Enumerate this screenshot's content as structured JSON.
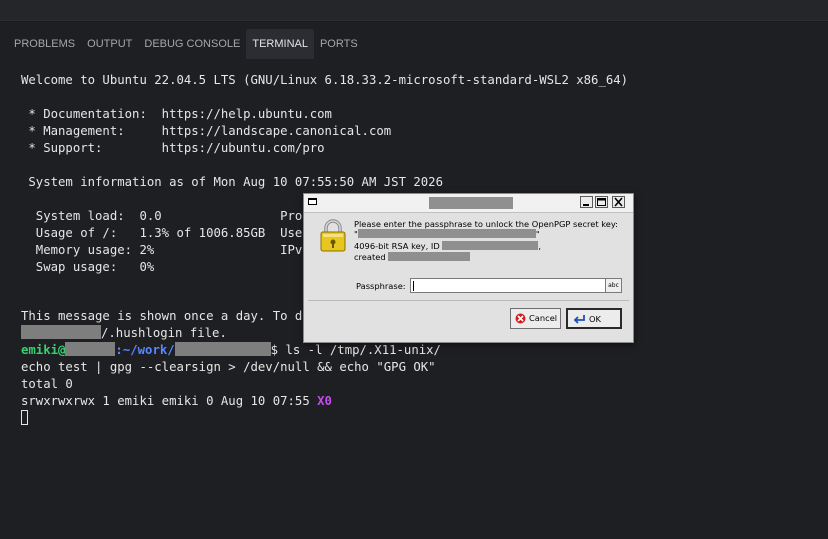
{
  "panel": {
    "tabs": [
      {
        "label": "PROBLEMS"
      },
      {
        "label": "OUTPUT"
      },
      {
        "label": "DEBUG CONSOLE"
      },
      {
        "label": "TERMINAL",
        "active": true
      },
      {
        "label": "PORTS"
      }
    ]
  },
  "terminal": {
    "welcome": "Welcome to Ubuntu 22.04.5 LTS (GNU/Linux 6.18.33.2-microsoft-standard-WSL2 x86_64)",
    "doc": " * Documentation:  https://help.ubuntu.com",
    "mgmt": " * Management:     https://landscape.canonical.com",
    "support": " * Support:        https://ubuntu.com/pro",
    "sysinfo": " System information as of Mon Aug 10 07:55:50 AM JST 2026",
    "load": "  System load:  0.0                Proc",
    "usage": "  Usage of /:   1.3% of 1006.85GB  User",
    "memory": "  Memory usage: 2%                 IPv4",
    "swap": "  Swap usage:   0%",
    "motd1": "This message is shown once a day. To dis",
    "motd2": "/.hushlogin file.",
    "prompt_user": "emiki@",
    "prompt_path": ":~/work/",
    "prompt_cmd": "$ ls -l /tmp/.X11-unix/",
    "cmd2": "echo test | gpg --clearsign > /dev/null && echo \"GPG OK\"",
    "total": "total 0",
    "ls_line": "srwxrwxrwx 1 emiki emiki 0 Aug 10 07:55 ",
    "ls_name": "X0"
  },
  "dialog": {
    "message": "Please enter the passphrase to unlock the OpenPGP secret key:",
    "quote_open": "\"",
    "quote_close": "\"",
    "key_info": "4096-bit RSA key, ID",
    "key_end": ",",
    "created": "created",
    "passphrase_label": "Passphrase:",
    "passphrase_value": "",
    "abc_label": "abc",
    "cancel_label": "Cancel",
    "ok_label": "OK",
    "minimize_icon": "minimize-icon",
    "maximize_icon": "maximize-icon",
    "close_icon": "close-icon"
  }
}
